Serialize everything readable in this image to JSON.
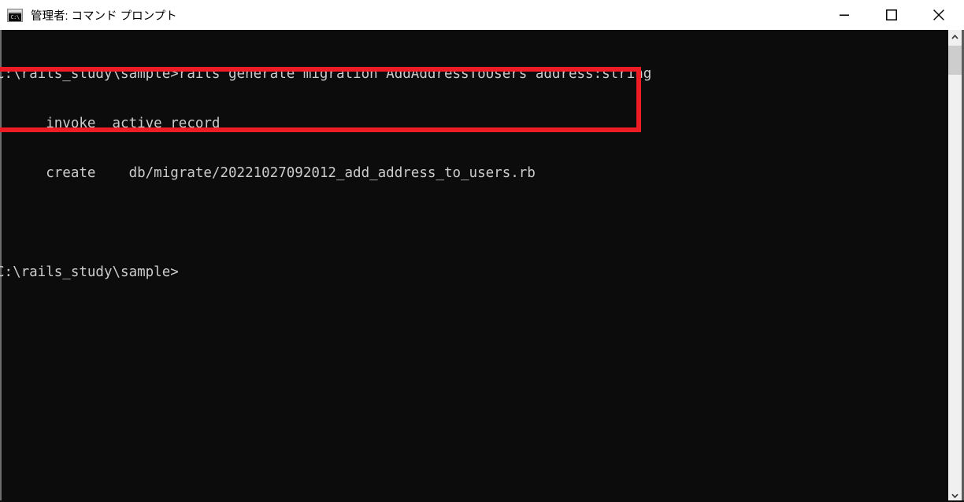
{
  "window": {
    "title": "管理者: コマンド プロンプト",
    "icon": "cmd-prompt-icon",
    "icon_text": "C:\\",
    "background_color": "#0c0c0c",
    "titlebar_color": "#ffffff",
    "controls": {
      "minimize": "minimize-icon",
      "maximize": "maximize-icon",
      "close": "close-icon"
    }
  },
  "terminal": {
    "foreground_color": "#cccccc",
    "lines": [
      "C:\\rails_study\\sample>rails generate migration AddAddressToUsers address:string",
      "      invoke  active_record",
      "      create    db/migrate/20221027092012_add_address_to_users.rb",
      "",
      "C:\\rails_study\\sample>"
    ],
    "prompt": "C:\\rails_study\\sample>",
    "command": "rails generate migration AddAddressToUsers address:string",
    "output": [
      "      invoke  active_record",
      "      create    db/migrate/20221027092012_add_address_to_users.rb"
    ],
    "migration_file": "db/migrate/20221027092012_add_address_to_users.rb"
  },
  "annotation": {
    "type": "highlight-rectangle",
    "color": "#ee1c25"
  },
  "scrollbar": {
    "up_arrow": "chevron-up-icon",
    "down_arrow": "chevron-down-icon",
    "track_color": "#f0f0f0",
    "thumb_color": "#cdcdcd"
  }
}
